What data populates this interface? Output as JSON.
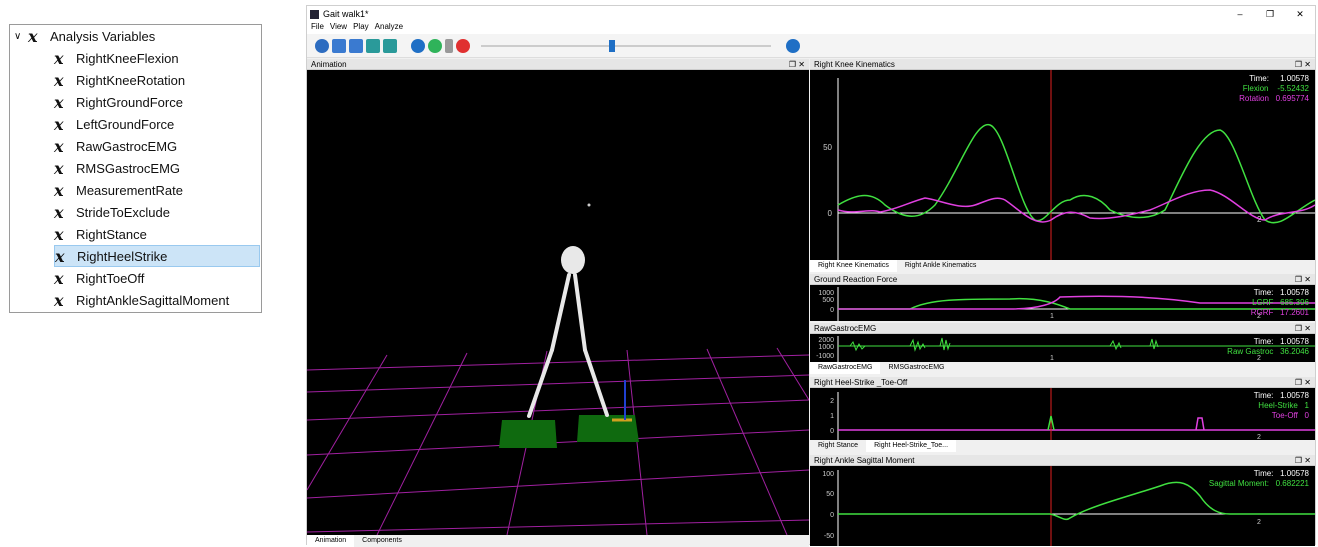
{
  "tree": {
    "root": "Analysis Variables",
    "items": [
      "RightKneeFlexion",
      "RightKneeRotation",
      "RightGroundForce",
      "LeftGroundForce",
      "RawGastrocEMG",
      "RMSGastrocEMG",
      "MeasurementRate",
      "StrideToExclude",
      "RightStance",
      "RightHeelStrike",
      "RightToeOff",
      "RightAnkleSagittalMoment"
    ],
    "selected": "RightHeelStrike"
  },
  "window": {
    "title": "Gait walk1*",
    "menu": [
      "File",
      "View",
      "Play",
      "Analyze"
    ]
  },
  "anim": {
    "title": "Animation",
    "tabs": [
      "Animation",
      "Components"
    ]
  },
  "knee": {
    "title": "Right Knee Kinematics",
    "tabs": [
      "Right Knee Kinematics",
      "Right Ankle Kinematics"
    ],
    "time_label": "Time:",
    "time": "1.00578",
    "flexion_label": "Flexion",
    "flexion": "-5.52432",
    "rotation_label": "Rotation",
    "rotation": "0.695774",
    "tick50": "50",
    "tick0": "0",
    "tickx": "2"
  },
  "grf": {
    "title": "Ground Reaction Force",
    "time_label": "Time:",
    "time": "1.00578",
    "lgrf_label": "LGRF",
    "lgrf": "685.396",
    "rgrf_label": "RGRF",
    "rgrf": "17.2601",
    "t1000": "1000",
    "t500": "500",
    "t0": "0",
    "tx1": "1",
    "tx2": "2"
  },
  "emg": {
    "title": "RawGastrocEMG",
    "tabs": [
      "RawGastrocEMG",
      "RMSGastrocEMG"
    ],
    "time_label": "Time:",
    "time": "1.00578",
    "raw_label": "Raw Gastroc",
    "raw": "36.2046",
    "t2000": "2000",
    "t1000": "1000",
    "tn1000": "-1000",
    "tx1": "1",
    "tx2": "2"
  },
  "heel": {
    "title": "Right Heel-Strike _Toe-Off",
    "tabs": [
      "Right Stance",
      "Right Heel-Strike_Toe..."
    ],
    "time_label": "Time:",
    "time": "1.00578",
    "hs_label": "Heel-Strike",
    "hs": "1",
    "to_label": "Toe-Off",
    "to": "0",
    "t2": "2",
    "t1": "1",
    "t0": "0",
    "tx": "2"
  },
  "ankle": {
    "title": "Right Ankle Sagittal Moment",
    "time_label": "Time:",
    "time": "1.00578",
    "sm_label": "Sagittal Moment:",
    "sm": "0.682221",
    "t100": "100",
    "t50": "50",
    "t0": "0",
    "tn50": "-50",
    "tx": "2"
  }
}
